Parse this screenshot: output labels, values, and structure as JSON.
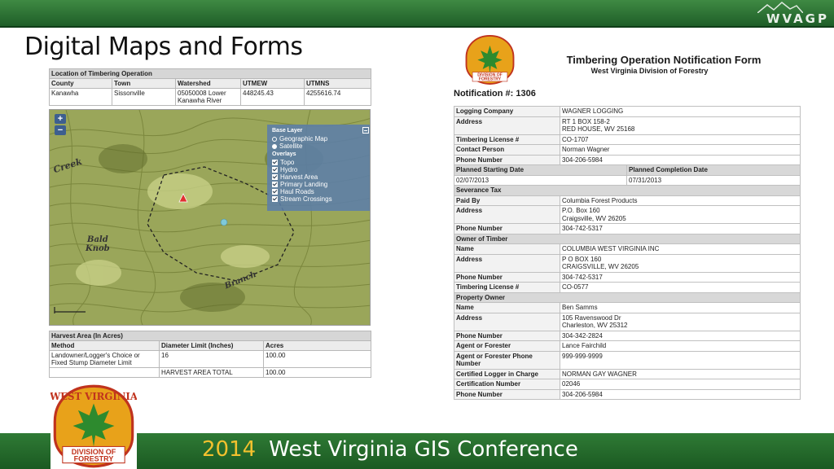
{
  "slide": {
    "title": "Digital Maps and Forms",
    "brand": "WVAGP",
    "footer_year": "2014",
    "footer_text": "West Virginia GIS Conference",
    "colors": {
      "band_green": "#2f7a35",
      "year_gold": "#f2c12e"
    }
  },
  "location": {
    "caption": "Location of Timbering Operation",
    "headers": [
      "County",
      "Town",
      "Watershed",
      "UTMEW",
      "UTMNS"
    ],
    "row": [
      "Kanawha",
      "Sissonville",
      "05050008 Lower Kanawha River",
      "448245.43",
      "4255616.74"
    ]
  },
  "map": {
    "zoom_in": "+",
    "zoom_out": "−",
    "labels": {
      "creek": "Creek",
      "bald": "Bald",
      "knob": "Knob",
      "branch": "Branch"
    },
    "layer_panel": {
      "base_layer_title": "Base Layer",
      "base_layers": [
        "Geographic Map",
        "Satellite"
      ],
      "overlays_title": "Overlays",
      "overlays": [
        "Topo",
        "Hydro",
        "Harvest Area",
        "Primary Landing",
        "Haul Roads",
        "Stream Crossings"
      ]
    }
  },
  "harvest": {
    "caption": "Harvest Area (In Acres)",
    "headers": [
      "Method",
      "Diameter Limit (Inches)",
      "Acres"
    ],
    "row": [
      "Landowner/Logger's Choice or Fixed Stump Diameter Limit",
      "16",
      "100.00"
    ],
    "total_label": "HARVEST AREA TOTAL",
    "total": "100.00"
  },
  "form": {
    "title": "Timbering Operation Notification Form",
    "subtitle": "West Virginia Division of Forestry",
    "notification": "Notification #: 1306",
    "logging_company_label": "Logging Company",
    "logging_company": "WAGNER LOGGING",
    "address_label": "Address",
    "logging_address_1": "RT 1 BOX 158-2",
    "logging_address_2": "RED HOUSE, WV 25168",
    "timbering_license_label": "Timbering License #",
    "timbering_license": "CO-1707",
    "contact_label": "Contact Person",
    "contact": "Norman Wagner",
    "phone_label": "Phone Number",
    "logging_phone": "304-206-5984",
    "planned_start_label": "Planned Starting Date",
    "planned_start": "02/07/2013",
    "planned_end_label": "Planned Completion Date",
    "planned_end": "07/31/2013",
    "severance_label": "Severance Tax",
    "paid_by_label": "Paid By",
    "paid_by": "Columbia Forest Products",
    "paid_address_1": "P.O. Box 160",
    "paid_address_2": "Craigsville, WV 26205",
    "paid_phone": "304-742-5317",
    "owner_timber_label": "Owner of Timber",
    "name_label": "Name",
    "owner_name": "COLUMBIA WEST VIRGINIA INC",
    "owner_address_1": "P O BOX 160",
    "owner_address_2": "CRAIGSVILLE, WV 26205",
    "owner_phone": "304-742-5317",
    "owner_license": "CO-0577",
    "property_owner_label": "Property Owner",
    "prop_name": "Ben Samms",
    "prop_address_1": "105 Ravenswood Dr",
    "prop_address_2": "Charleston, WV 25312",
    "prop_phone": "304-342-2824",
    "agent_label": "Agent or Forester",
    "agent": "Lance Fairchild",
    "agent_phone_label": "Agent or Forester Phone Number",
    "agent_phone": "999-999-9999",
    "certified_label": "Certified Logger in Charge",
    "certified": "NORMAN GAY WAGNER",
    "cert_number_label": "Certification Number",
    "cert_number": "02046",
    "cert_phone": "304-206-5984"
  },
  "seal": {
    "top_text": "WEST VIRGINIA",
    "line1": "DIVISION OF",
    "line2": "FORESTRY",
    "colors": {
      "ring": "#e8a21a",
      "leaf": "#2d8a2e",
      "border": "#c0331e"
    }
  }
}
